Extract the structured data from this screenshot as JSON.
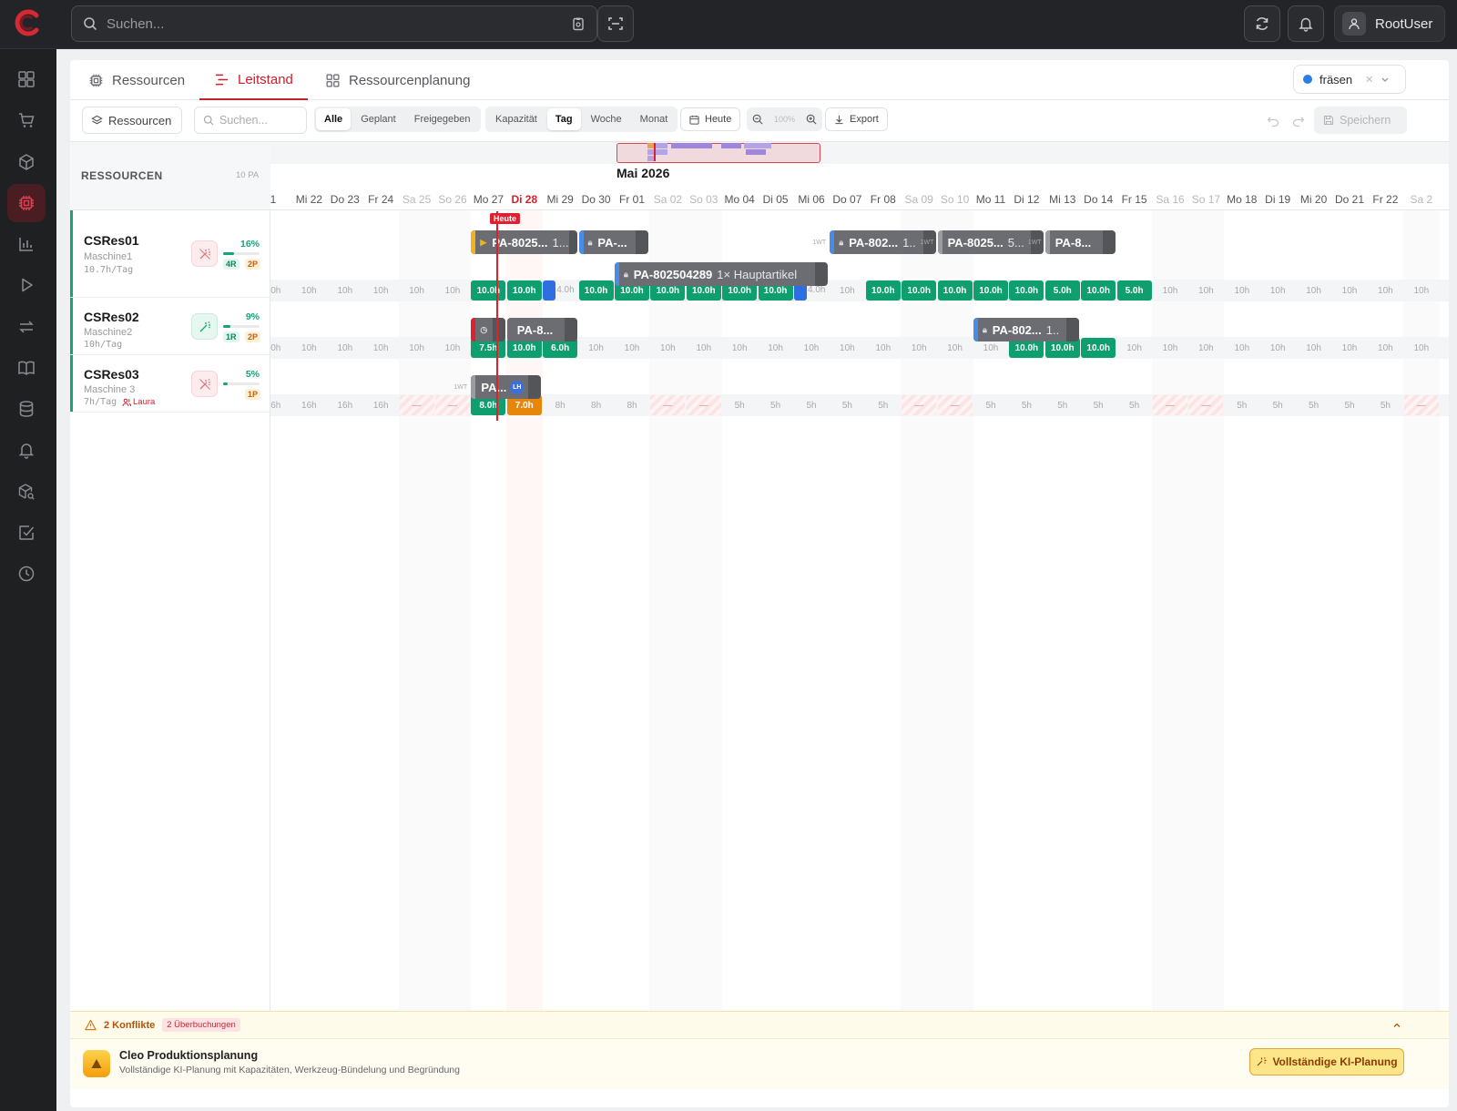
{
  "topbar": {
    "search_placeholder": "Suchen...",
    "user_name": "RootUser"
  },
  "tabs": [
    {
      "label": "Ressourcen",
      "icon": "cpu-icon"
    },
    {
      "label": "Leitstand",
      "icon": "gantt-icon",
      "active": true
    },
    {
      "label": "Ressourcenplanung",
      "icon": "grid-icon"
    }
  ],
  "filter_chip": {
    "label": "fräsen",
    "color": "#2a7de1"
  },
  "toolbar": {
    "resources_button": "Ressourcen",
    "search_placeholder": "Suchen...",
    "status_filters": [
      "Alle",
      "Geplant",
      "Freigegeben"
    ],
    "status_selected": "Alle",
    "view_modes": [
      "Kapazität",
      "Tag",
      "Woche",
      "Monat"
    ],
    "view_selected": "Tag",
    "today_button": "Heute",
    "zoom": "100%",
    "export_button": "Export",
    "save_button": "Speichern"
  },
  "resource_header": {
    "title": "RESSOURCEN",
    "count": "10 PA"
  },
  "resources": [
    {
      "name": "CSRes01",
      "machine": "Maschine1",
      "hours": "10.7h/Tag",
      "utilization": "16%",
      "util_value": 16,
      "badge_r": "4R",
      "badge_p": "2P",
      "assignee": ""
    },
    {
      "name": "CSRes02",
      "machine": "Maschine2",
      "hours": "10h/Tag",
      "utilization": "9%",
      "util_value": 9,
      "badge_r": "1R",
      "badge_p": "2P",
      "assignee": ""
    },
    {
      "name": "CSRes03",
      "machine": "Maschine 3",
      "hours": "7h/Tag",
      "utilization": "5%",
      "util_value": 5,
      "badge_r": "",
      "badge_p": "1P",
      "assignee": "Laura"
    }
  ],
  "timeline": {
    "month": "Mai 2026",
    "today_label": "Heute",
    "days": [
      "1",
      "Mi 22",
      "Do 23",
      "Fr 24",
      "Sa 25",
      "So 26",
      "Mo 27",
      "Di 28",
      "Mi 29",
      "Do 30",
      "Fr 01",
      "Sa 02",
      "So 03",
      "Mo 04",
      "Di 05",
      "Mi 06",
      "Do 07",
      "Fr 08",
      "Sa 09",
      "So 10",
      "Mo 11",
      "Di 12",
      "Mi 13",
      "Do 14",
      "Fr 15",
      "Sa 16",
      "So 17",
      "Mo 18",
      "Di 19",
      "Mi 20",
      "Do 21",
      "Fr 22",
      "Sa 2"
    ],
    "weekend_index": [
      4,
      5,
      11,
      12,
      18,
      19,
      25,
      26,
      32
    ],
    "today_index": 7,
    "jobs": [
      {
        "row": 0,
        "lane": 0,
        "text": "PA-8025...",
        "sub": "1...",
        "stripe": "#f3b21b",
        "start": 6,
        "span": 3,
        "icon": "play"
      },
      {
        "row": 0,
        "lane": 0,
        "text": "PA-...",
        "sub": "",
        "stripe": "#4a8be8",
        "start": 9,
        "span": 2,
        "icon": "lock"
      },
      {
        "row": 0,
        "lane": 0,
        "text": "PA-802...",
        "sub": "1..",
        "stripe": "#4a8be8",
        "start": 16,
        "span": 3,
        "icon": "lock",
        "pre": "1WT"
      },
      {
        "row": 0,
        "lane": 0,
        "text": "PA-8025...",
        "sub": "5...",
        "stripe": "#9a9ca1",
        "start": 19,
        "span": 3,
        "icon": "",
        "pre": "1WT"
      },
      {
        "row": 0,
        "lane": 0,
        "text": "PA-8...",
        "sub": "",
        "stripe": "#9a9ca1",
        "start": 22,
        "span": 2,
        "icon": "",
        "pre": "1WT"
      },
      {
        "row": 0,
        "lane": 1,
        "text": "PA-802504289",
        "sub": "1× Hauptartikel",
        "stripe": "#4a8be8",
        "start": 10,
        "span": 6,
        "icon": "lock"
      },
      {
        "row": 1,
        "lane": 0,
        "text": "",
        "sub": "",
        "stripe": "#e0202e",
        "start": 6,
        "span": 1,
        "icon": "clock"
      },
      {
        "row": 1,
        "lane": 0,
        "text": "PA-8...",
        "sub": "",
        "stripe": "#6b6d73",
        "start": 7,
        "span": 2,
        "icon": ""
      },
      {
        "row": 1,
        "lane": 0,
        "text": "PA-802...",
        "sub": "1..",
        "stripe": "#4a8be8",
        "start": 20,
        "span": 3,
        "icon": "lock"
      },
      {
        "row": 2,
        "lane": 0,
        "text": "PA...",
        "sub": "",
        "stripe": "#9a9ca1",
        "start": 6,
        "span": 2,
        "icon": "",
        "pre": "1WT",
        "avatar": "LH"
      }
    ],
    "capacity": [
      [
        "10h",
        "10h",
        "10h",
        "10h",
        "10h",
        "10h",
        "10.0h",
        "10.0h",
        "4.0h",
        "10.0h",
        "10.0h",
        "10.0h",
        "10.0h",
        "10.0h",
        "10.0h",
        "4.0h",
        "10h",
        "10.0h",
        "10.0h",
        "10.0h",
        "10.0h",
        "10.0h",
        "5.0h",
        "10.0h",
        "5.0h",
        "10h",
        "10h",
        "10h",
        "10h",
        "10h",
        "10h",
        "10h",
        "10h"
      ],
      [
        "10h",
        "10h",
        "10h",
        "10h",
        "10h",
        "10h",
        "7.5h",
        "10.0h",
        "6.0h",
        "10h",
        "10h",
        "10h",
        "10h",
        "10h",
        "10h",
        "10h",
        "10h",
        "10h",
        "10h",
        "10h",
        "10h",
        "10.0h",
        "10.0h",
        "10.0h",
        "10h",
        "10h",
        "10h",
        "10h",
        "10h",
        "10h",
        "10h",
        "10h",
        "10h"
      ],
      [
        "16h",
        "16h",
        "16h",
        "16h",
        "—",
        "—",
        "8.0h",
        "7.0h",
        "8h",
        "8h",
        "8h",
        "—",
        "—",
        "5h",
        "5h",
        "5h",
        "5h",
        "5h",
        "—",
        "—",
        "5h",
        "5h",
        "5h",
        "5h",
        "5h",
        "—",
        "—",
        "5h",
        "5h",
        "5h",
        "5h",
        "5h",
        "—"
      ]
    ],
    "capacity_style": [
      [
        "l",
        "l",
        "l",
        "l",
        "l",
        "l",
        "g",
        "g",
        "r",
        "g",
        "g",
        "g",
        "g",
        "g",
        "g",
        "r",
        "l",
        "g",
        "g",
        "g",
        "g",
        "g",
        "g",
        "g",
        "g",
        "l",
        "l",
        "l",
        "l",
        "l",
        "l",
        "l",
        "l"
      ],
      [
        "l",
        "l",
        "l",
        "l",
        "l",
        "l",
        "g",
        "g",
        "g",
        "l",
        "l",
        "l",
        "l",
        "l",
        "l",
        "l",
        "l",
        "l",
        "l",
        "l",
        "l",
        "g",
        "g",
        "g",
        "l",
        "l",
        "l",
        "l",
        "l",
        "l",
        "l",
        "l",
        "l"
      ],
      [
        "l",
        "l",
        "l",
        "l",
        "h",
        "h",
        "g",
        "o",
        "l",
        "l",
        "l",
        "h",
        "h",
        "l",
        "l",
        "l",
        "l",
        "l",
        "h",
        "h",
        "l",
        "l",
        "l",
        "l",
        "l",
        "h",
        "h",
        "l",
        "l",
        "l",
        "l",
        "l",
        "h"
      ]
    ]
  },
  "conflicts": {
    "text": "2 Konflikte",
    "pill": "2 Überbuchungen"
  },
  "cleo": {
    "title": "Cleo Produktionsplanung",
    "subtitle": "Vollständige KI-Planung mit Kapazitäten, Werkzeug-Bündelung und Begründung",
    "button": "Vollständige KI-Planung"
  }
}
